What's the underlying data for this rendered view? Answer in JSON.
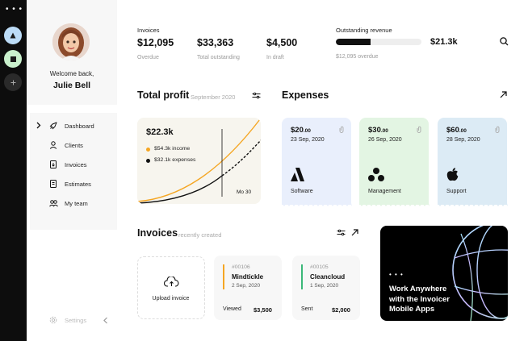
{
  "rail": {
    "dots": "• • •",
    "workspaces": [
      {
        "name": "workspace-blue",
        "color": "#bcdcf7",
        "icon": "triangle-icon"
      },
      {
        "name": "workspace-green",
        "color": "#c9f0cc",
        "icon": "square-icon"
      },
      {
        "name": "add-workspace",
        "color": "#2a2a2a",
        "icon": "plus-icon"
      }
    ]
  },
  "sidebar": {
    "welcome": "Welcome back,",
    "user_name": "Julie Bell",
    "nav": [
      {
        "label": "Dashboard",
        "icon": "rocket-icon",
        "active": true
      },
      {
        "label": "Clients",
        "icon": "person-icon"
      },
      {
        "label": "Invoices",
        "icon": "invoice-doc-icon"
      },
      {
        "label": "Estimates",
        "icon": "estimate-doc-icon"
      },
      {
        "label": "My team",
        "icon": "team-icon"
      }
    ],
    "settings_label": "Settings"
  },
  "summary": {
    "section_label": "Invoices",
    "stats": [
      {
        "value": "$12,095",
        "label": "Overdue"
      },
      {
        "value": "$33,363",
        "label": "Total outstanding"
      },
      {
        "value": "$4,500",
        "label": "In draft"
      }
    ],
    "outstanding": {
      "label": "Outstanding revenue",
      "value": "$21.3k",
      "sub": "$12,095 overdue",
      "progress_fraction": 0.41
    }
  },
  "profit": {
    "title": "Total profit",
    "period": "September 2020",
    "total": "$22.3k",
    "income_label": "$54.3k income",
    "expenses_label": "$32.1k expenses",
    "marker_label": "Mo 30",
    "income_color": "#f5a623",
    "expenses_color": "#111111"
  },
  "expenses": {
    "title": "Expenses",
    "cards": [
      {
        "amount": "$20",
        "cents": ".00",
        "date": "23 Sep, 2020",
        "category": "Software",
        "icon": "software-logo-icon",
        "color": "#e9effc"
      },
      {
        "amount": "$30",
        "cents": ".00",
        "date": "26 Sep, 2020",
        "category": "Management",
        "icon": "management-logo-icon",
        "color": "#e3f5e3"
      },
      {
        "amount": "$60",
        "cents": ".00",
        "date": "28 Sep, 2020",
        "category": "Support",
        "icon": "apple-icon",
        "color": "#dcebf5"
      }
    ]
  },
  "invoices": {
    "title": "Invoices",
    "subtitle": "recently created",
    "upload_label": "Upload invoice",
    "items": [
      {
        "number": "#00106",
        "client": "Mindtickle",
        "date": "2 Sep, 2020",
        "status": "Viewed",
        "amount": "$3,500",
        "accent": "#f5a623"
      },
      {
        "number": "#00105",
        "client": "Cleancloud",
        "date": "1 Sep, 2020",
        "status": "Sent",
        "amount": "$2,000",
        "accent": "#3cb878"
      }
    ]
  },
  "promo": {
    "dots": "• • •",
    "line1": "Work Anywhere",
    "line2": "with the Invoicer",
    "line3": "Mobile Apps"
  }
}
